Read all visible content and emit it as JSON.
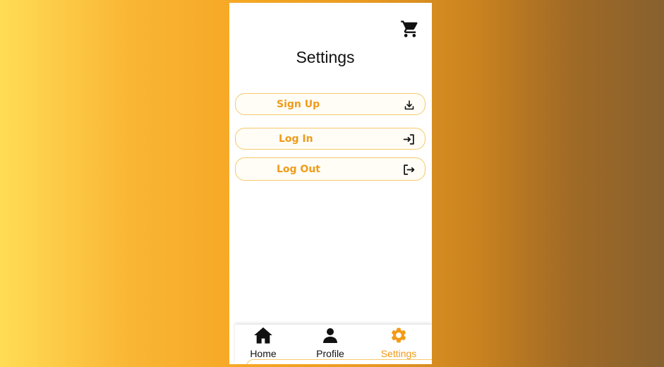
{
  "page": {
    "title": "Settings"
  },
  "header": {
    "cart_icon": "shopping-cart-icon"
  },
  "menu": [
    {
      "label": "Sign Up",
      "icon": "download-icon"
    },
    {
      "label": "Log In",
      "icon": "login-icon"
    },
    {
      "label": "Log Out",
      "icon": "logout-icon"
    }
  ],
  "nav": [
    {
      "label": "Home",
      "icon": "home-icon",
      "active": false
    },
    {
      "label": "Profile",
      "icon": "person-icon",
      "active": false
    },
    {
      "label": "Settings",
      "icon": "gear-icon",
      "active": true
    }
  ],
  "colors": {
    "accent": "#f39a16",
    "button_text": "#ef9b1b",
    "button_border": "#f6c96a",
    "text": "#111111"
  }
}
